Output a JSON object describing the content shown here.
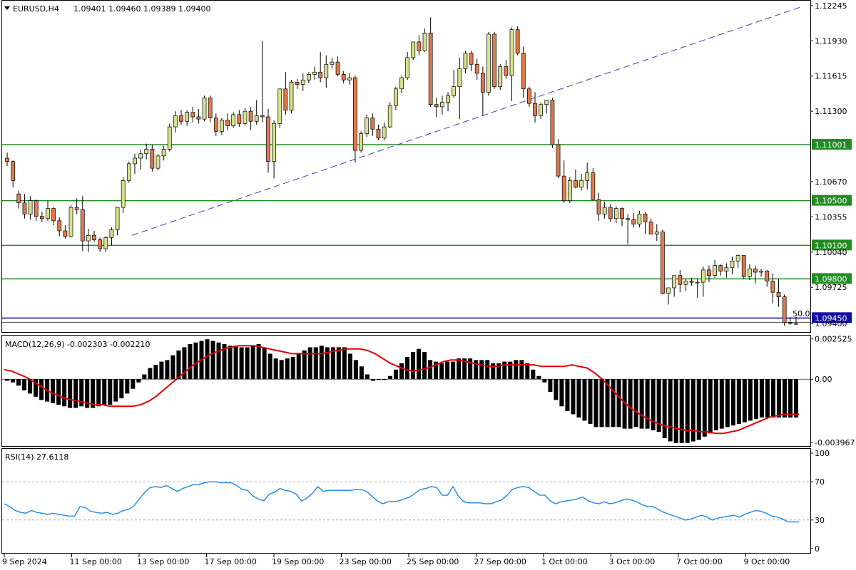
{
  "window": {
    "symbol_label": "EURUSD,H4",
    "ohlc_label": "1.09401 1.09460 1.09389 1.09400"
  },
  "colors": {
    "bull_body": "#d8e08c",
    "bear_body": "#e07a4a",
    "candle_outline": "#000000",
    "support_line": "#228b22",
    "trend_line": "#3b3bbf",
    "price_line": "#1010a0",
    "macd_hist": "#000000",
    "macd_signal": "#e00000",
    "rsi_line": "#2b8fe0",
    "level_dotted": "#aaaaaa"
  },
  "price_axis": {
    "ticks": [
      "1.12245",
      "1.11930",
      "1.11615",
      "1.11300",
      "1.10670",
      "1.10355",
      "1.10040",
      "1.09725",
      "1.09400"
    ],
    "range": [
      1.0935,
      1.1227
    ]
  },
  "horizontal_levels": [
    {
      "price": 1.11001,
      "label": "1.11001"
    },
    {
      "price": 1.105,
      "label": "1.10500"
    },
    {
      "price": 1.101,
      "label": "1.10100"
    },
    {
      "price": 1.098,
      "label": "1.09800"
    },
    {
      "price": 1.0945,
      "label": "1.09450"
    }
  ],
  "fib_label": "50.0",
  "time_axis": {
    "labels": [
      "9 Sep 2024",
      "11 Sep 00:00",
      "13 Sep 00:00",
      "17 Sep 00:00",
      "19 Sep 00:00",
      "23 Sep 00:00",
      "25 Sep 00:00",
      "27 Sep 00:00",
      "1 Oct 00:00",
      "3 Oct 00:00",
      "7 Oct 00:00",
      "9 Oct 00:00"
    ]
  },
  "macd": {
    "label": "MACD(12,26,9) -0.002303 -0.002210",
    "ticks": [
      "0.002525",
      "0.00",
      "-0.003967"
    ],
    "range": [
      -0.0041,
      0.0026
    ]
  },
  "rsi": {
    "label": "RSI(14) 27.6118",
    "ticks": [
      "100",
      "70",
      "30",
      "0"
    ],
    "levels": [
      70,
      30
    ],
    "range": [
      0,
      100
    ]
  },
  "chart_data": {
    "type": "candlestick",
    "title": "EURUSD,H4",
    "candles": [
      [
        1.1088,
        1.1093,
        1.1081,
        1.1085
      ],
      [
        1.1085,
        1.1086,
        1.1062,
        1.1068
      ],
      [
        1.1056,
        1.1059,
        1.1043,
        1.1048
      ],
      [
        1.1048,
        1.1056,
        1.1034,
        1.1038
      ],
      [
        1.1038,
        1.1054,
        1.1033,
        1.105
      ],
      [
        1.105,
        1.1051,
        1.1032,
        1.1036
      ],
      [
        1.1036,
        1.104,
        1.1031,
        1.1034
      ],
      [
        1.1034,
        1.105,
        1.1032,
        1.1043
      ],
      [
        1.1043,
        1.1044,
        1.1028,
        1.1032
      ],
      [
        1.1032,
        1.1035,
        1.1018,
        1.1023
      ],
      [
        1.1023,
        1.1028,
        1.1016,
        1.1018
      ],
      [
        1.1018,
        1.1046,
        1.1017,
        1.1044
      ],
      [
        1.1044,
        1.1052,
        1.1038,
        1.1042
      ],
      [
        1.1042,
        1.1054,
        1.1005,
        1.1014
      ],
      [
        1.1014,
        1.1025,
        1.1004,
        1.1019
      ],
      [
        1.1019,
        1.1023,
        1.1013,
        1.1015
      ],
      [
        1.1015,
        1.1017,
        1.1004,
        1.1007
      ],
      [
        1.1007,
        1.1018,
        1.1004,
        1.1017
      ],
      [
        1.1017,
        1.1026,
        1.101,
        1.1024
      ],
      [
        1.1024,
        1.1042,
        1.1019,
        1.1044
      ],
      [
        1.1044,
        1.1071,
        1.1039,
        1.1068
      ],
      [
        1.1068,
        1.1085,
        1.1066,
        1.1083
      ],
      [
        1.1083,
        1.1092,
        1.1074,
        1.1088
      ],
      [
        1.1088,
        1.1096,
        1.1078,
        1.1092
      ],
      [
        1.1092,
        1.1101,
        1.1087,
        1.1096
      ],
      [
        1.1096,
        1.11,
        1.1076,
        1.1079
      ],
      [
        1.1079,
        1.1092,
        1.1077,
        1.109
      ],
      [
        1.109,
        1.1099,
        1.1086,
        1.1096
      ],
      [
        1.1096,
        1.1119,
        1.1094,
        1.1116
      ],
      [
        1.1116,
        1.113,
        1.1111,
        1.1126
      ],
      [
        1.1126,
        1.1131,
        1.1118,
        1.1121
      ],
      [
        1.1121,
        1.1131,
        1.1117,
        1.1129
      ],
      [
        1.1129,
        1.1134,
        1.112,
        1.1125
      ],
      [
        1.1125,
        1.1132,
        1.1119,
        1.1123
      ],
      [
        1.1123,
        1.1144,
        1.1121,
        1.1142
      ],
      [
        1.1142,
        1.1144,
        1.112,
        1.1124
      ],
      [
        1.1124,
        1.1128,
        1.1108,
        1.1112
      ],
      [
        1.1112,
        1.1124,
        1.1109,
        1.1122
      ],
      [
        1.1122,
        1.1128,
        1.1113,
        1.1117
      ],
      [
        1.1117,
        1.1129,
        1.1115,
        1.1127
      ],
      [
        1.1127,
        1.1131,
        1.1116,
        1.1119
      ],
      [
        1.1119,
        1.1133,
        1.1117,
        1.113
      ],
      [
        1.113,
        1.1134,
        1.1113,
        1.1121
      ],
      [
        1.1121,
        1.114,
        1.1118,
        1.1126
      ],
      [
        1.1126,
        1.1193,
        1.112,
        1.1125
      ],
      [
        1.1125,
        1.1132,
        1.1075,
        1.1085
      ],
      [
        1.1085,
        1.1122,
        1.107,
        1.1119
      ],
      [
        1.1119,
        1.1147,
        1.1115,
        1.115
      ],
      [
        1.115,
        1.1165,
        1.1127,
        1.1131
      ],
      [
        1.1131,
        1.1158,
        1.1128,
        1.1156
      ],
      [
        1.1156,
        1.1159,
        1.115,
        1.1154
      ],
      [
        1.1154,
        1.1164,
        1.1148,
        1.1158
      ],
      [
        1.1158,
        1.1165,
        1.1155,
        1.1163
      ],
      [
        1.1163,
        1.117,
        1.1158,
        1.1165
      ],
      [
        1.1165,
        1.1183,
        1.1156,
        1.116
      ],
      [
        1.116,
        1.118,
        1.1151,
        1.1172
      ],
      [
        1.1172,
        1.1178,
        1.1168,
        1.1174
      ],
      [
        1.1174,
        1.1179,
        1.1161,
        1.1163
      ],
      [
        1.1163,
        1.1166,
        1.1155,
        1.1158
      ],
      [
        1.1158,
        1.1164,
        1.1154,
        1.116
      ],
      [
        1.116,
        1.1162,
        1.1084,
        1.1095
      ],
      [
        1.1095,
        1.1112,
        1.1093,
        1.111
      ],
      [
        1.111,
        1.1127,
        1.1107,
        1.1124
      ],
      [
        1.1124,
        1.1128,
        1.1108,
        1.1114
      ],
      [
        1.1114,
        1.1118,
        1.1104,
        1.1106
      ],
      [
        1.1106,
        1.112,
        1.1104,
        1.1116
      ],
      [
        1.1116,
        1.1138,
        1.1115,
        1.1135
      ],
      [
        1.1135,
        1.1152,
        1.1131,
        1.115
      ],
      [
        1.115,
        1.1162,
        1.1146,
        1.116
      ],
      [
        1.116,
        1.1183,
        1.1158,
        1.1178
      ],
      [
        1.1178,
        1.1188,
        1.1176,
        1.1192
      ],
      [
        1.1192,
        1.1198,
        1.118,
        1.1184
      ],
      [
        1.1184,
        1.1204,
        1.1183,
        1.12
      ],
      [
        1.12,
        1.1214,
        1.1134,
        1.1136
      ],
      [
        1.1136,
        1.1142,
        1.1125,
        1.1134
      ],
      [
        1.1134,
        1.1144,
        1.1127,
        1.1138
      ],
      [
        1.1138,
        1.1147,
        1.113,
        1.1144
      ],
      [
        1.1144,
        1.1167,
        1.1142,
        1.1152
      ],
      [
        1.1152,
        1.1178,
        1.1123,
        1.1168
      ],
      [
        1.1168,
        1.1184,
        1.1164,
        1.1182
      ],
      [
        1.1182,
        1.1184,
        1.1166,
        1.1172
      ],
      [
        1.1172,
        1.1177,
        1.1158,
        1.1164
      ],
      [
        1.1164,
        1.117,
        1.1126,
        1.1147
      ],
      [
        1.1147,
        1.1201,
        1.1144,
        1.1199
      ],
      [
        1.1199,
        1.1201,
        1.115,
        1.1152
      ],
      [
        1.1152,
        1.1172,
        1.1149,
        1.117
      ],
      [
        1.117,
        1.1176,
        1.1159,
        1.1162
      ],
      [
        1.1162,
        1.1205,
        1.1139,
        1.1203
      ],
      [
        1.1203,
        1.1206,
        1.118,
        1.1182
      ],
      [
        1.1182,
        1.1188,
        1.1142,
        1.115
      ],
      [
        1.115,
        1.1152,
        1.1134,
        1.1137
      ],
      [
        1.1137,
        1.1147,
        1.112,
        1.1126
      ],
      [
        1.1126,
        1.1138,
        1.1123,
        1.1136
      ],
      [
        1.1136,
        1.114,
        1.1128,
        1.114
      ],
      [
        1.114,
        1.1142,
        1.1097,
        1.11
      ],
      [
        1.11,
        1.1105,
        1.107,
        1.1072
      ],
      [
        1.1072,
        1.1086,
        1.1048,
        1.105
      ],
      [
        1.105,
        1.1071,
        1.1048,
        1.1068
      ],
      [
        1.1068,
        1.1078,
        1.1061,
        1.1062
      ],
      [
        1.1062,
        1.1074,
        1.1059,
        1.1068
      ],
      [
        1.1068,
        1.1084,
        1.106,
        1.1075
      ],
      [
        1.1075,
        1.1079,
        1.105,
        1.1051
      ],
      [
        1.1051,
        1.1057,
        1.1032,
        1.1038
      ],
      [
        1.1038,
        1.1049,
        1.1034,
        1.1044
      ],
      [
        1.1044,
        1.1047,
        1.1031,
        1.1034
      ],
      [
        1.1034,
        1.1045,
        1.103,
        1.1043
      ],
      [
        1.1043,
        1.1044,
        1.1027,
        1.1034
      ],
      [
        1.1034,
        1.1038,
        1.1011,
        1.1033
      ],
      [
        1.1033,
        1.1039,
        1.1026,
        1.1029
      ],
      [
        1.1029,
        1.1041,
        1.1026,
        1.1038
      ],
      [
        1.1038,
        1.104,
        1.102,
        1.1031
      ],
      [
        1.1031,
        1.1034,
        1.102,
        1.102
      ],
      [
        1.102,
        1.1029,
        1.1014,
        1.1022
      ],
      [
        1.1022,
        1.1024,
        1.0966,
        1.0967
      ],
      [
        1.0967,
        1.097,
        1.0957,
        1.0972
      ],
      [
        1.0972,
        1.0983,
        1.0964,
        1.0983
      ],
      [
        1.0983,
        1.0988,
        1.0968,
        1.0975
      ],
      [
        1.0975,
        1.098,
        1.0969,
        1.0978
      ],
      [
        1.0978,
        1.0981,
        1.0974,
        1.0977
      ],
      [
        1.0977,
        1.098,
        1.0963,
        1.0977
      ],
      [
        1.0977,
        1.0991,
        1.0964,
        1.0988
      ],
      [
        1.0988,
        1.0992,
        1.0977,
        1.0983
      ],
      [
        1.0983,
        1.0997,
        1.0981,
        1.0992
      ],
      [
        1.0992,
        1.0993,
        1.0983,
        1.0987
      ],
      [
        1.0987,
        1.0994,
        1.0981,
        1.099
      ],
      [
        1.099,
        1.1,
        1.0984,
        1.0996
      ],
      [
        1.0996,
        1.1002,
        1.099,
        1.1001
      ],
      [
        1.1001,
        1.1001,
        1.098,
        1.0982
      ],
      [
        1.0982,
        1.0993,
        1.0979,
        1.0989
      ],
      [
        1.0989,
        1.0992,
        1.0976,
        1.0986
      ],
      [
        1.0986,
        1.0989,
        1.0982,
        1.0987
      ],
      [
        1.0987,
        1.0988,
        1.0973,
        1.0978
      ],
      [
        1.0978,
        1.0985,
        1.0958,
        1.0968
      ],
      [
        1.0968,
        1.098,
        1.0955,
        1.0964
      ],
      [
        1.0964,
        1.0966,
        1.0938,
        1.0941
      ],
      [
        1.0941,
        1.0946,
        1.09389,
        1.094
      ],
      [
        1.094,
        1.0946,
        1.09389,
        1.094
      ]
    ],
    "trend_line": [
      [
        0.16,
        1.1019
      ],
      [
        1.0,
        1.1224
      ]
    ],
    "macd_hist": [
      -0.0001,
      -0.0002,
      -0.0004,
      -0.0007,
      -0.0009,
      -0.0011,
      -0.0013,
      -0.0014,
      -0.0015,
      -0.0016,
      -0.0017,
      -0.0018,
      -0.0018,
      -0.0017,
      -0.0018,
      -0.0018,
      -0.0017,
      -0.0016,
      -0.0016,
      -0.0014,
      -0.0012,
      -0.0009,
      -0.0006,
      -0.0002,
      0.0003,
      0.0007,
      0.0009,
      0.0011,
      0.0012,
      0.0015,
      0.0018,
      0.002,
      0.0022,
      0.0023,
      0.0024,
      0.0025,
      0.0024,
      0.0023,
      0.0022,
      0.0021,
      0.0021,
      0.002,
      0.002,
      0.0021,
      0.0022,
      0.002,
      0.0016,
      0.0013,
      0.0012,
      0.0013,
      0.0014,
      0.0016,
      0.0018,
      0.002,
      0.002,
      0.0021,
      0.002,
      0.002,
      0.002,
      0.002,
      0.0016,
      0.0012,
      0.0008,
      0.0003,
      -0.0001,
      0.0,
      0.0,
      0.0002,
      0.0006,
      0.001,
      0.0014,
      0.0017,
      0.0019,
      0.0017,
      0.0012,
      0.0011,
      0.001,
      0.0011,
      0.0011,
      0.0013,
      0.0013,
      0.0013,
      0.0012,
      0.0012,
      0.0012,
      0.001,
      0.001,
      0.0011,
      0.0011,
      0.0012,
      0.0012,
      0.001,
      0.0006,
      0.0002,
      -0.0002,
      -0.0008,
      -0.0013,
      -0.0017,
      -0.002,
      -0.0022,
      -0.0024,
      -0.0026,
      -0.0028,
      -0.003,
      -0.003,
      -0.003,
      -0.003,
      -0.003,
      -0.0031,
      -0.0031,
      -0.003,
      -0.0031,
      -0.0031,
      -0.0032,
      -0.0033,
      -0.0037,
      -0.0039,
      -0.004,
      -0.004,
      -0.004,
      -0.0039,
      -0.0038,
      -0.0036,
      -0.0034,
      -0.0032,
      -0.0031,
      -0.003,
      -0.0029,
      -0.0028,
      -0.0027,
      -0.0026,
      -0.0025,
      -0.0024,
      -0.0024,
      -0.0024,
      -0.0024,
      -0.0024,
      -0.0024,
      -0.0024
    ],
    "macd_signal": [
      0.0006,
      0.0005,
      0.0003,
      0.0001,
      -0.0002,
      -0.0005,
      -0.0008,
      -0.001,
      -0.0012,
      -0.0013,
      -0.0014,
      -0.0015,
      -0.0016,
      -0.0016,
      -0.0017,
      -0.0017,
      -0.0017,
      -0.0017,
      -0.0016,
      -0.0014,
      -0.0011,
      -0.0007,
      -0.0003,
      0.0001,
      0.0005,
      0.0009,
      0.0012,
      0.0015,
      0.0017,
      0.0019,
      0.002,
      0.0021,
      0.0021,
      0.0021,
      0.002,
      0.0019,
      0.0018,
      0.0017,
      0.0016,
      0.0016,
      0.0016,
      0.0016,
      0.0016,
      0.0017,
      0.0018,
      0.0019,
      0.0019,
      0.0019,
      0.0018,
      0.0016,
      0.0013,
      0.001,
      0.0008,
      0.0006,
      0.0005,
      0.0006,
      0.0007,
      0.0009,
      0.0011,
      0.0012,
      0.0012,
      0.0011,
      0.001,
      0.0009,
      0.0008,
      0.0008,
      0.0009,
      0.0009,
      0.0009,
      0.0009,
      0.0009,
      0.0008,
      0.0008,
      0.0008,
      0.0008,
      0.0009,
      0.0008,
      0.0007,
      0.0004,
      0.0,
      -0.0005,
      -0.001,
      -0.0015,
      -0.0019,
      -0.0022,
      -0.0025,
      -0.0027,
      -0.0029,
      -0.003,
      -0.0031,
      -0.0032,
      -0.0032,
      -0.0033,
      -0.0033,
      -0.0034,
      -0.0034,
      -0.0033,
      -0.0032,
      -0.003,
      -0.0028,
      -0.0026,
      -0.0024,
      -0.0023,
      -0.0022,
      -0.0022,
      -0.0022
    ],
    "rsi": [
      47,
      44,
      40,
      38,
      37,
      40,
      38,
      37,
      36,
      37,
      36,
      35,
      34,
      34,
      44,
      43,
      39,
      38,
      37,
      38,
      36,
      37,
      40,
      41,
      45,
      52,
      59,
      64,
      65,
      64,
      66,
      63,
      60,
      63,
      65,
      67,
      67,
      69,
      70,
      70,
      69,
      69,
      69,
      66,
      62,
      61,
      55,
      52,
      50,
      57,
      59,
      63,
      61,
      60,
      57,
      50,
      53,
      58,
      65,
      60,
      61,
      61,
      61,
      61,
      61,
      62,
      62,
      60,
      55,
      50,
      47,
      49,
      49,
      50,
      52,
      54,
      58,
      62,
      63,
      65,
      64,
      56,
      56,
      65,
      55,
      49,
      48,
      48,
      48,
      47,
      47,
      49,
      51,
      56,
      62,
      64,
      65,
      64,
      60,
      56,
      56,
      50,
      47,
      49,
      50,
      51,
      52,
      54,
      50,
      48,
      47,
      49,
      47,
      48,
      50,
      52,
      51,
      49,
      46,
      44,
      44,
      41,
      38,
      36,
      34,
      32,
      30,
      31,
      33,
      35,
      33,
      30,
      32,
      33,
      34,
      35,
      33,
      36,
      38,
      40,
      39,
      37,
      34,
      33,
      31,
      28,
      28,
      28
    ]
  }
}
